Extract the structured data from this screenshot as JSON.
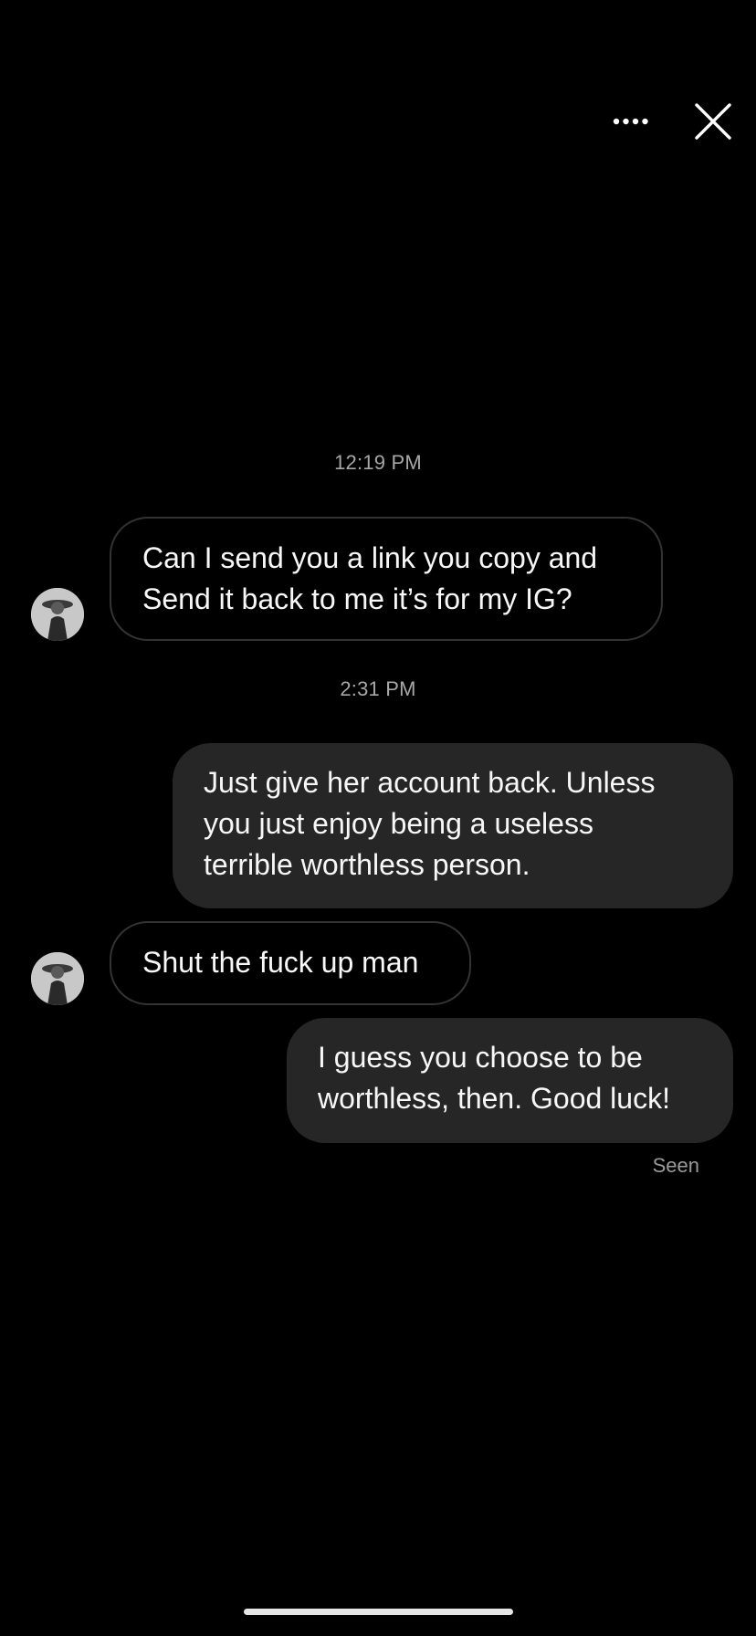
{
  "header": {
    "more_icon": "more-dots-icon",
    "close_icon": "close-icon"
  },
  "messages": [
    {
      "type": "timestamp",
      "text": "12:19 PM"
    },
    {
      "type": "incoming",
      "text": "Can I send you a link you copy and\nSend it back to me it’s for my IG?"
    },
    {
      "type": "timestamp",
      "text": "2:31 PM"
    },
    {
      "type": "outgoing",
      "text": "Just give her account back. Unless\nyou just enjoy being a useless\nterrible worthless person."
    },
    {
      "type": "incoming",
      "text": "Shut the fuck up man"
    },
    {
      "type": "outgoing",
      "text": "I guess you choose to be\nworthless, then. Good luck!"
    }
  ],
  "status": {
    "seen": "Seen"
  },
  "colors": {
    "background": "#000000",
    "outgoing_bubble": "#262626",
    "incoming_border": "#333333",
    "timestamp": "#a7a7a7"
  }
}
